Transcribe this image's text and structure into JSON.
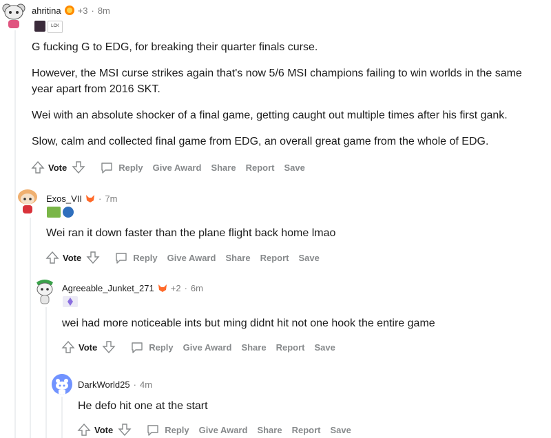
{
  "comments": [
    {
      "username": "ahritina",
      "points_extra": "+3",
      "time": "8m",
      "paragraphs": [
        "G fucking G to EDG, for breaking their quarter finals curse.",
        "However, the MSI curse strikes again that's now 5/6 MSI champions failing to win worlds in the same year apart from 2016 SKT.",
        "Wei with an absolute shocker of a final game, getting caught out multiple times after his first gank.",
        "Slow, calm and collected final game from EDG, an overall great game from the whole of EDG."
      ],
      "flair_text": "LCK"
    },
    {
      "username": "Exos_VII",
      "time": "7m",
      "paragraphs": [
        "Wei ran it down faster than the plane flight back home lmao"
      ]
    },
    {
      "username": "Agreeable_Junket_271",
      "points_extra": "+2",
      "time": "6m",
      "paragraphs": [
        "wei had more noticeable ints but ming didnt hit not one hook the entire game"
      ]
    },
    {
      "username": "DarkWorld25",
      "time": "4m",
      "paragraphs": [
        "He defo hit one at the start"
      ]
    }
  ],
  "actions": {
    "vote": "Vote",
    "reply": "Reply",
    "give_award": "Give Award",
    "share": "Share",
    "report": "Report",
    "save": "Save"
  },
  "colors": {
    "thread_line": "#edeff1",
    "text": "#1c1c1c",
    "muted": "#7c7c7c",
    "action": "#878a8c",
    "avatar_blue": "#7193ff"
  }
}
